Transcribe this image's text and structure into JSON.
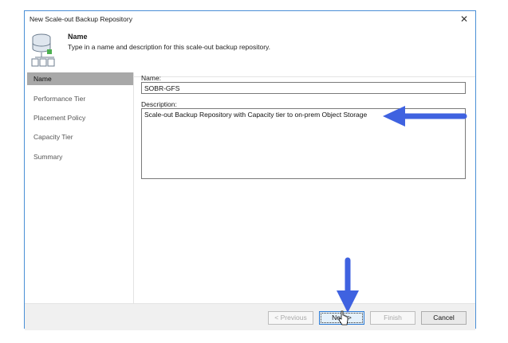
{
  "window": {
    "title": "New Scale-out Backup Repository"
  },
  "header": {
    "title": "Name",
    "description": "Type in a name and description for this scale-out backup repository."
  },
  "steps": [
    {
      "label": "Name",
      "active": true
    },
    {
      "label": "Performance Tier",
      "active": false
    },
    {
      "label": "Placement Policy",
      "active": false
    },
    {
      "label": "Capacity Tier",
      "active": false
    },
    {
      "label": "Summary",
      "active": false
    }
  ],
  "form": {
    "name_label": "Name:",
    "name_value": "SOBR-GFS",
    "description_label": "Description:",
    "description_value": "Scale-out Backup Repository with Capacity tier to on-prem Object Storage"
  },
  "buttons": {
    "previous": "< Previous",
    "next": "Next >",
    "finish": "Finish",
    "cancel": "Cancel"
  },
  "colors": {
    "accent_arrow": "#3f62e0",
    "active_step": "#a8a8a8",
    "window_border": "#4a8fd6"
  }
}
